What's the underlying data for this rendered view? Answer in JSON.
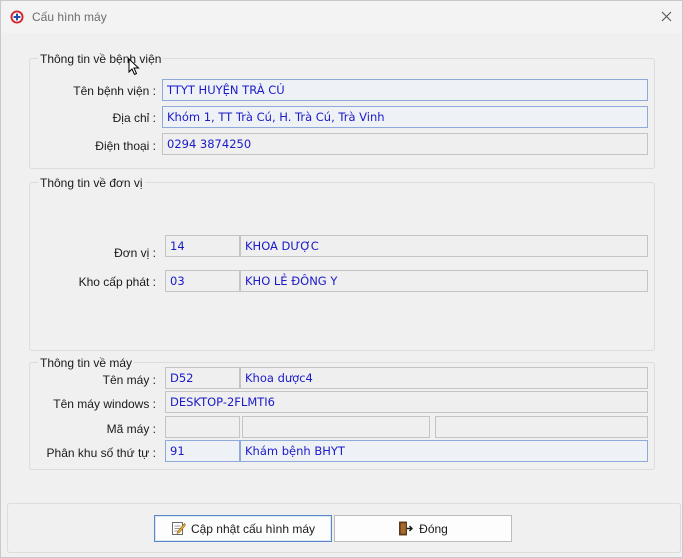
{
  "window": {
    "title": "Cấu hình máy"
  },
  "hospital": {
    "group_title": "Thông tin về bệnh viện",
    "name_label": "Tên bệnh viện :",
    "name_value": "TTYT HUYỆN TRÀ CÚ",
    "address_label": "Địa chỉ :",
    "address_value": "Khóm 1, TT Trà Cú, H. Trà Cú, Trà Vinh",
    "phone_label": "Điện thoại :",
    "phone_value": "0294 3874250"
  },
  "unit": {
    "group_title": "Thông tin về đơn vị",
    "dept_label": "Đơn vị :",
    "dept_code": "14",
    "dept_name": "KHOA DƯỢC",
    "warehouse_label": "Kho cấp phát :",
    "warehouse_code": "03",
    "warehouse_name": "KHO LẺ ĐÔNG Y"
  },
  "machine": {
    "group_title": "Thông tin về máy",
    "name_label": "Tên máy :",
    "name_code": "D52",
    "name_desc": "Khoa dược4",
    "windows_label": "Tên máy windows :",
    "windows_value": "DESKTOP-2FLMTI6",
    "id_label": "Mã máy :",
    "id_1": "",
    "id_2": "",
    "id_3": "",
    "queue_label": "Phân khu số thứ tự :",
    "queue_code": "91",
    "queue_name": "Khám bệnh BHYT"
  },
  "buttons": {
    "update_label": "Cập nhật cấu hình máy",
    "close_label": "Đóng"
  },
  "icons": {
    "app": "red-cross-icon",
    "close": "close-icon",
    "update": "edit-document-icon",
    "exit": "exit-door-icon"
  }
}
